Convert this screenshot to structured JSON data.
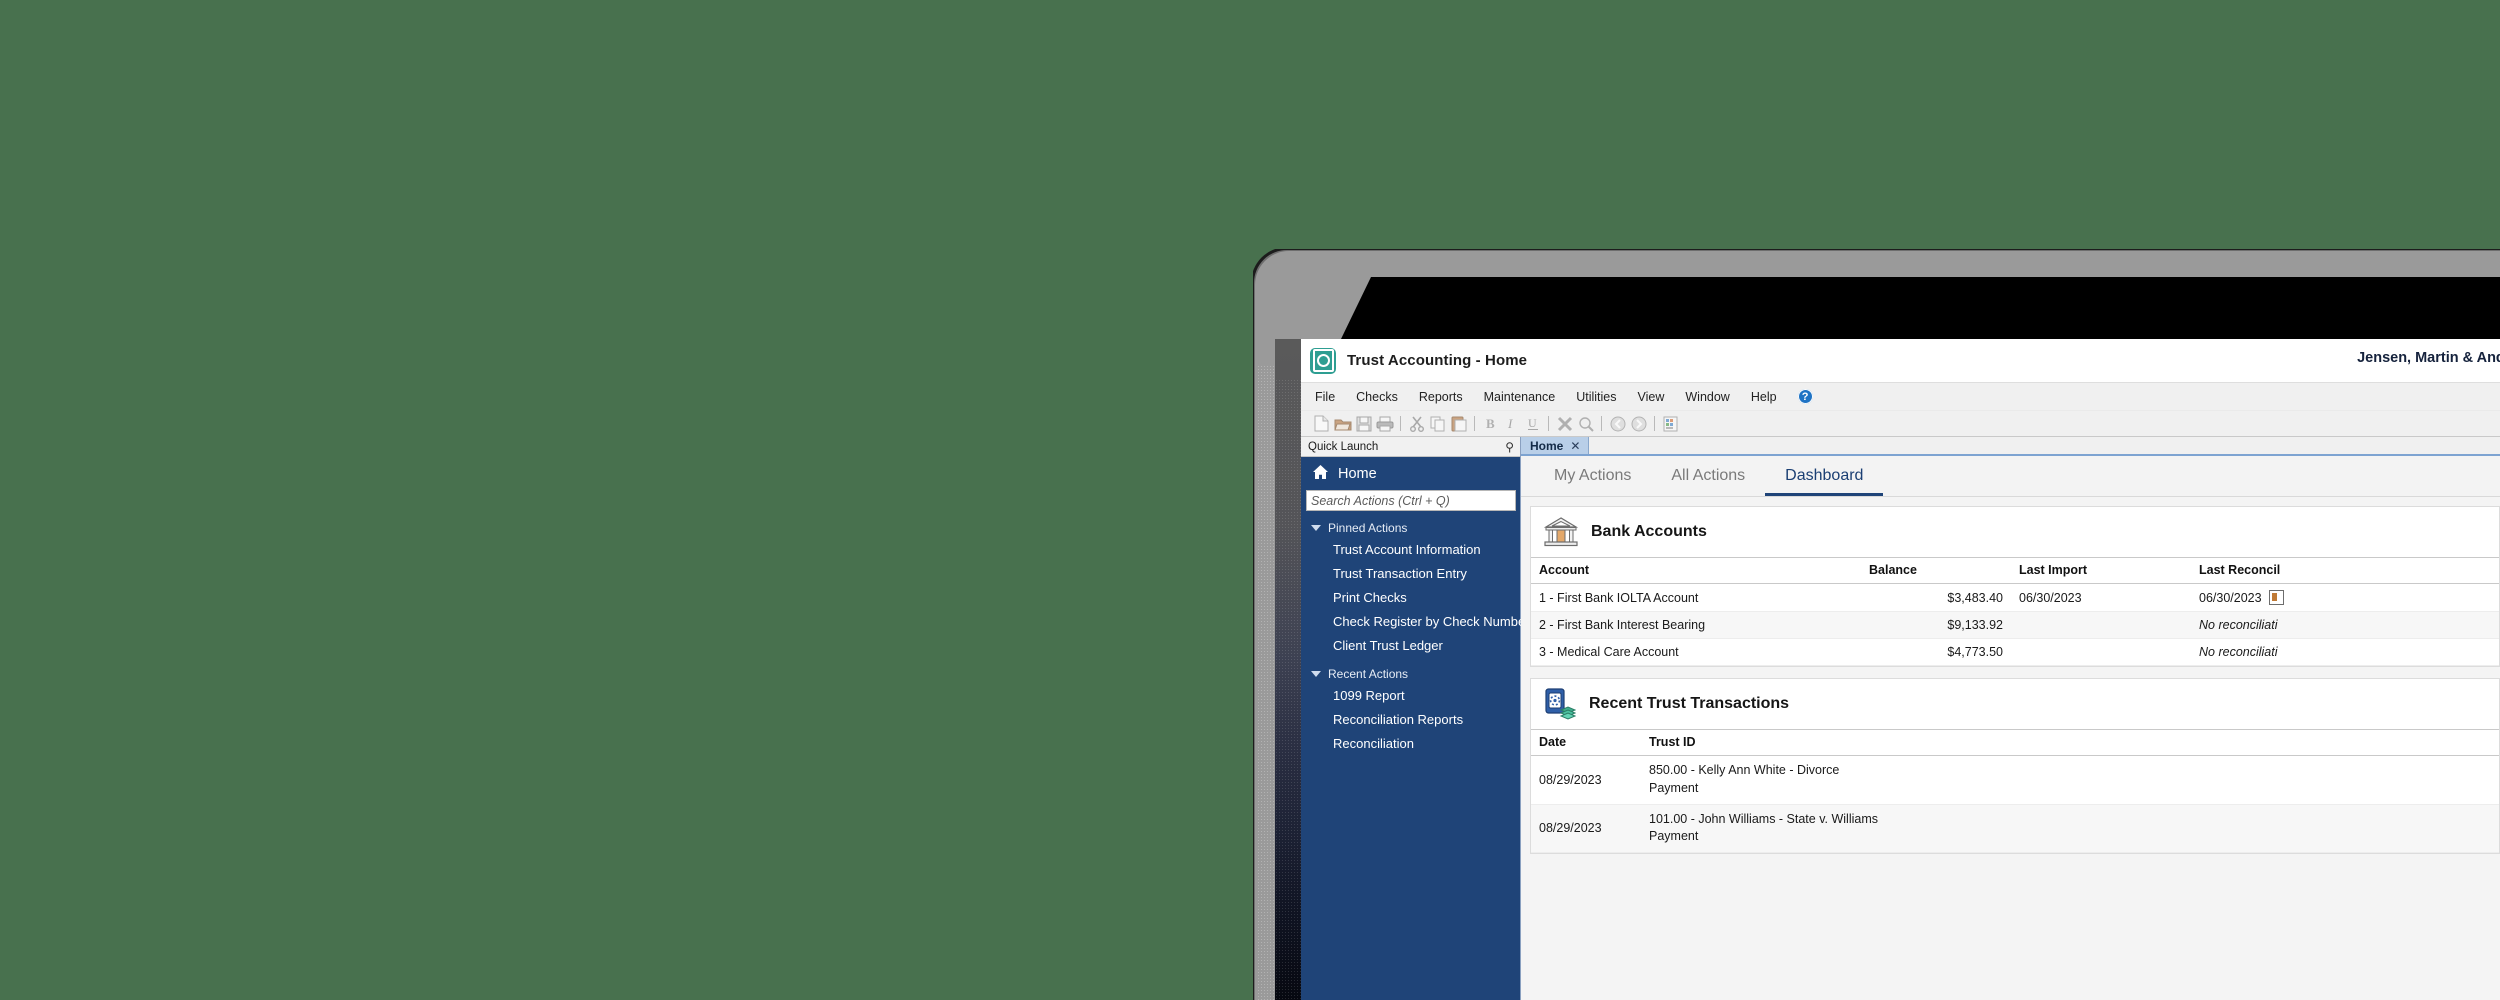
{
  "desktop": {
    "background_color": "#48714e"
  },
  "window": {
    "title": "Trust Accounting - Home",
    "firm_name": "Jensen, Martin & Anderson, P",
    "app_icon": "safe-icon"
  },
  "menubar": {
    "items": [
      "File",
      "Checks",
      "Reports",
      "Maintenance",
      "Utilities",
      "View",
      "Window",
      "Help"
    ],
    "help_badge": "?"
  },
  "toolbar": {
    "icons": [
      "new-document-icon",
      "open-folder-icon",
      "save-icon",
      "print-icon",
      "cut-icon",
      "copy-icon",
      "paste-icon",
      "bold-icon",
      "italic-icon",
      "underline-icon",
      "spellcheck-icon",
      "find-icon",
      "back-icon",
      "forward-icon",
      "report-grid-icon"
    ]
  },
  "sidebar": {
    "panel_title": "Quick Launch",
    "pin_icon": "pin-icon",
    "home_label": "Home",
    "home_icon": "home-icon",
    "search": {
      "placeholder": "Search Actions (Ctrl + Q)",
      "value": ""
    },
    "groups": [
      {
        "label": "Pinned Actions",
        "expanded": true,
        "items": [
          "Trust Account Information",
          "Trust Transaction Entry",
          "Print Checks",
          "Check Register by Check Number",
          "Client Trust Ledger"
        ]
      },
      {
        "label": "Recent Actions",
        "expanded": true,
        "items": [
          "1099 Report",
          "Reconciliation Reports",
          "Reconciliation"
        ]
      }
    ]
  },
  "document_tabs": [
    {
      "label": "Home",
      "close_icon": "close-icon",
      "active": true
    }
  ],
  "sub_tabs": [
    {
      "label": "My Actions",
      "active": false
    },
    {
      "label": "All Actions",
      "active": false
    },
    {
      "label": "Dashboard",
      "active": true
    }
  ],
  "bank_accounts": {
    "title": "Bank Accounts",
    "icon": "bank-icon",
    "columns": [
      "Account",
      "Balance",
      "Last Import",
      "Last Reconcil"
    ],
    "rows": [
      {
        "account": "1 - First Bank IOLTA Account",
        "balance": "$3,483.40",
        "last_import": "06/30/2023",
        "last_reconciled": "06/30/2023",
        "reconciled_icon": "report-icon"
      },
      {
        "account": "2 - First Bank Interest Bearing",
        "balance": "$9,133.92",
        "last_import": "",
        "last_reconciled": "No reconciliati",
        "reconciled_icon": ""
      },
      {
        "account": "3 - Medical Care Account",
        "balance": "$4,773.50",
        "last_import": "",
        "last_reconciled": "No reconciliati",
        "reconciled_icon": ""
      }
    ]
  },
  "recent_transactions": {
    "title": "Recent Trust Transactions",
    "icon": "trust-transaction-icon",
    "columns": [
      "Date",
      "Trust ID"
    ],
    "rows": [
      {
        "date": "08/29/2023",
        "trust_id": "850.00 - Kelly Ann White - Divorce\nPayment"
      },
      {
        "date": "08/29/2023",
        "trust_id": "101.00 - John Williams - State v. Williams\nPayment"
      }
    ]
  },
  "colors": {
    "sidebar": "#1f4478",
    "accent": "#1f4478",
    "app_icon": "#2e9e92",
    "tab_active": "#b9cfe8"
  }
}
